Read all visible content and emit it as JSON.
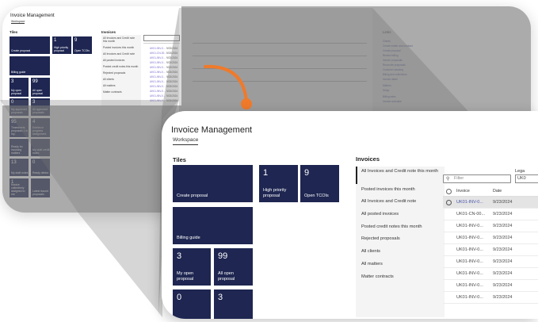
{
  "colors": {
    "tile_bg": "#1e2651",
    "accent_orange": "#f07a2a",
    "link_blue": "#4a55a8"
  },
  "app": {
    "title": "Invoice Management",
    "tab": "Workspace"
  },
  "tiles_heading": "Tiles",
  "invoices_heading": "Invoices",
  "tiles": [
    {
      "number": "",
      "label": "Create proposal"
    },
    {
      "number": "1",
      "label": "High priority proposal"
    },
    {
      "number": "9",
      "label": "Open TCOIs"
    },
    {
      "number": "",
      "label": "Billing guide"
    },
    {
      "number": "3",
      "label": "My open proposal"
    },
    {
      "number": "99",
      "label": "All open proposal"
    },
    {
      "number": "0",
      "label": ""
    },
    {
      "number": "3",
      "label": ""
    }
  ],
  "nav_items": [
    "All Invoices and Credit note this month",
    "Posted invoices this month",
    "All Invoices and Credit note",
    "All posted invoices",
    "Posted credit notes this month",
    "Rejected proposals",
    "All clients",
    "All matters",
    "Matter contracts"
  ],
  "filter_placeholder": "Filter",
  "right_label": "Lega",
  "right_value": "UK0",
  "grid": {
    "columns": [
      "Invoice",
      "Date"
    ],
    "rows": [
      {
        "invoice": "UK01-INV-0...",
        "date": "9/23/2024",
        "selected": true
      },
      {
        "invoice": "UK01-CN-00...",
        "date": "9/23/2024",
        "selected": false
      },
      {
        "invoice": "UK01-INV-0...",
        "date": "9/23/2024",
        "selected": false
      },
      {
        "invoice": "UK01-INV-0...",
        "date": "9/23/2024",
        "selected": false
      },
      {
        "invoice": "UK01-INV-0...",
        "date": "9/23/2024",
        "selected": false
      },
      {
        "invoice": "UK01-INV-0...",
        "date": "9/23/2024",
        "selected": false
      },
      {
        "invoice": "UK01-INV-0...",
        "date": "9/23/2024",
        "selected": false
      },
      {
        "invoice": "UK01-INV-0...",
        "date": "9/23/2024",
        "selected": false
      },
      {
        "invoice": "UK01-INV-0...",
        "date": "9/23/2024",
        "selected": false
      }
    ]
  },
  "bg": {
    "tiles": [
      {
        "number": "",
        "label": "Create proposal"
      },
      {
        "number": "1",
        "label": "High priority proposal"
      },
      {
        "number": "9",
        "label": "Open TCOIs"
      },
      {
        "number": "",
        "label": "Billing guide"
      },
      {
        "number": "3",
        "label": "My open proposal"
      },
      {
        "number": "99",
        "label": "All open proposal"
      },
      {
        "number": "0",
        "label": "My approved proposals"
      },
      {
        "number": "3",
        "label": "All approved proposals"
      },
      {
        "number": "95",
        "label": "Timesheets proposals 1 in my.."
      },
      {
        "number": "4",
        "label": "Entries in progress assignment"
      },
      {
        "number": "",
        "label": "Ready for invoicing matters"
      },
      {
        "number": "",
        "label": "My draft credit notes"
      },
      {
        "number": "13",
        "label": "My draft notes"
      },
      {
        "number": "0",
        "label": "Ready debtor"
      },
      {
        "number": "1",
        "label": "Invoice collectively assigned to me"
      },
      {
        "number": "",
        "label": "Latest issued proposals"
      }
    ],
    "nav_items": [
      "All Invoices and Credit note this month",
      "Posted invoices this month",
      "All Invoices and Credit note",
      "All posted invoices",
      "Posted credit notes this month",
      "Rejected proposals",
      "All clients",
      "All matters",
      "Matter contracts"
    ],
    "rows": [
      {
        "invoice": "UK01-INV-0...",
        "date": "9/23/2024"
      },
      {
        "invoice": "UK01-CN-00...",
        "date": "9/23/2024"
      },
      {
        "invoice": "UK01-INV-0...",
        "date": "9/23/2024"
      },
      {
        "invoice": "UK01-INV-0...",
        "date": "9/23/2024"
      },
      {
        "invoice": "UK01-INV-0...",
        "date": "9/23/2024"
      },
      {
        "invoice": "UK01-INV-0...",
        "date": "9/23/2024"
      },
      {
        "invoice": "UK01-INV-0...",
        "date": "9/23/2024"
      },
      {
        "invoice": "UK01-INV-0...",
        "date": "9/23/2024"
      },
      {
        "invoice": "UK01-INV-0...",
        "date": "9/23/2024"
      },
      {
        "invoice": "UK01-INV-0...",
        "date": "9/23/2024"
      },
      {
        "invoice": "UK01-INV-0...",
        "date": "9/23/2024"
      },
      {
        "invoice": "UK01-INV-0...",
        "date": "9/23/2024"
      }
    ],
    "links_heading": "Links",
    "links": [
      "Clients",
      "Create matter and contract",
      "Create proposal",
      "Review billing",
      "Invoice proposals",
      "Reconcile proposals",
      "Customer tracking",
      "Billing and collections",
      "Invoice detail",
      "Matters",
      "Setup",
      "Billing rates",
      "Invoice schedule"
    ]
  }
}
